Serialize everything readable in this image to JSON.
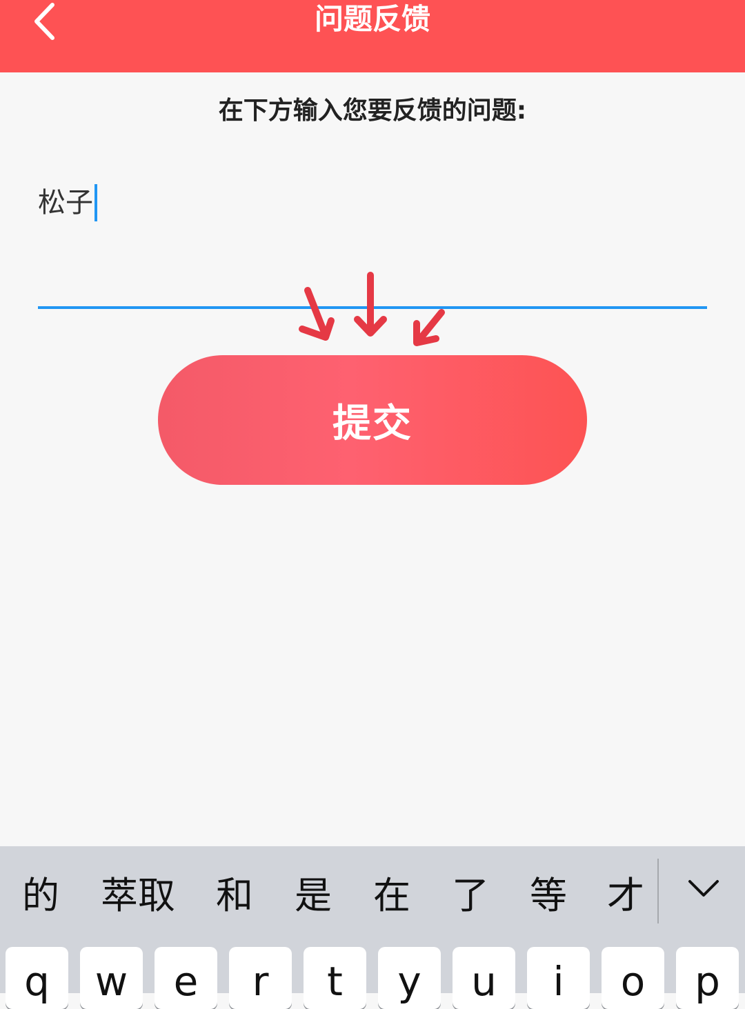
{
  "header": {
    "title": "问题反馈",
    "back_icon": "chevron-left-icon"
  },
  "prompt": "在下方输入您要反馈的问题:",
  "feedback_input": {
    "value": "松子"
  },
  "submit_label": "提交",
  "annotation": {
    "icon": "hand-drawn-arrows-icon",
    "color": "#e53945"
  },
  "colors": {
    "header": "#fe5254",
    "accent": "#2196f3",
    "button": "#fe5a64",
    "keyboard": "#d1d4da"
  },
  "keyboard": {
    "candidates": [
      "的",
      "萃取",
      "和",
      "是",
      "在",
      "了",
      "等",
      "才"
    ],
    "collapse_icon": "chevron-down-icon",
    "keys": [
      "q",
      "w",
      "e",
      "r",
      "t",
      "y",
      "u",
      "i",
      "o",
      "p"
    ]
  }
}
